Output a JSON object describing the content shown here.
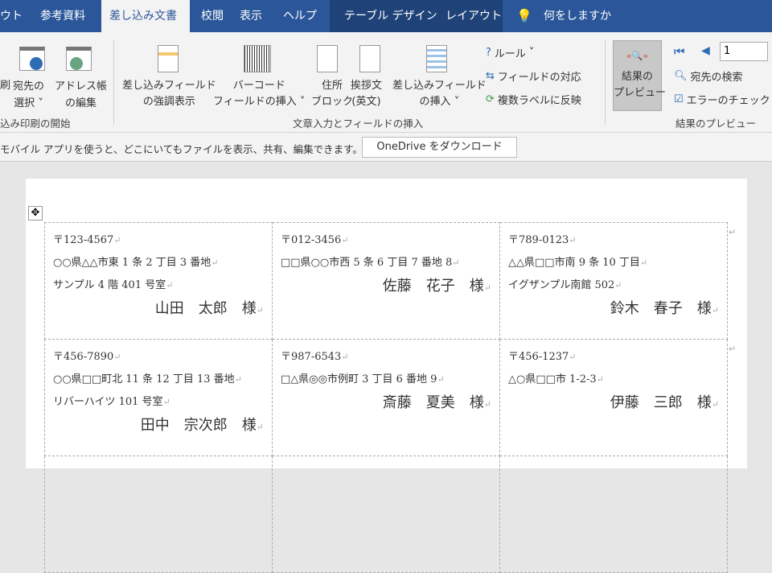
{
  "tabs": {
    "t0": "ウト",
    "t1": "参考資料",
    "t2": "差し込み文書",
    "t3": "校閲",
    "t4": "表示",
    "t5": "ヘルプ",
    "t6": "テーブル デザイン",
    "t7": "レイアウト",
    "tell": "何をしますか"
  },
  "ribbon": {
    "print": "刷",
    "recip1": "宛先の",
    "recip2": "選択",
    "addr1": "アドレス帳",
    "addr2": "の編集",
    "group1": "込み印刷の開始",
    "hl1": "差し込みフィールド",
    "hl2": "の強調表示",
    "bc1": "バーコード",
    "bc2": "フィールドの挿入",
    "ab1": "住所",
    "ab2": "ブロック",
    "gl1": "挨拶文",
    "gl2": "(英文)",
    "mf1": "差し込みフィールド",
    "mf2": "の挿入",
    "rules": "ルール",
    "match": "フィールドの対応",
    "update": "複数ラベルに反映",
    "group2": "文章入力とフィールドの挿入",
    "preview1": "結果の",
    "preview2": "プレビュー",
    "record": "1",
    "find": "宛先の検索",
    "check": "エラーのチェック",
    "group3": "結果のプレビュー"
  },
  "msgbar": {
    "text": "モバイル アプリを使うと、どこにいてもファイルを表示、共有、編集できます。",
    "button": "OneDrive をダウンロード"
  },
  "labels": [
    {
      "zip": "〒123-4567",
      "a1": "○○県△△市東 1 条 2 丁目 3 番地",
      "a2": "サンプル 4 階 401 号室",
      "name": "山田　太郎　様"
    },
    {
      "zip": "〒012-3456",
      "a1": "□□県○○市西 5 条 6 丁目 7 番地 8",
      "a2": "",
      "name": "佐藤　花子　様"
    },
    {
      "zip": "〒789-0123",
      "a1": "△△県□□市南 9 条 10 丁目",
      "a2": "イグザンプル南館 502",
      "name": "鈴木　春子　様"
    },
    {
      "zip": "〒456-7890",
      "a1": "○○県□□町北 11 条 12 丁目 13 番地",
      "a2": "リバーハイツ 101 号室",
      "name": "田中　宗次郎　様"
    },
    {
      "zip": "〒987-6543",
      "a1": "□△県◎◎市例町 3 丁目 6 番地 9",
      "a2": "",
      "name": "斎藤　夏美　様"
    },
    {
      "zip": "〒456-1237",
      "a1": "△○県□□市 1-2-3",
      "a2": "",
      "name": "伊藤　三郎　様"
    }
  ],
  "mark": "↵"
}
